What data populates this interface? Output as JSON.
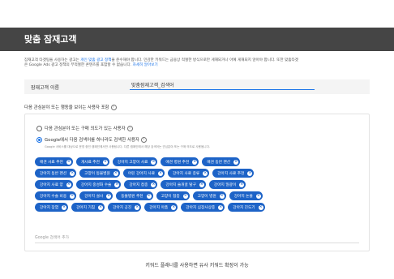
{
  "header": {
    "title": "맞춤 잠재고객"
  },
  "intro": {
    "line1_prefix": "잠재고객 타겟팅을 사용하는 광고는 ",
    "line1_link": "개인 맞춤 광고 정책",
    "line1_suffix": "을 준수해야 합니다. 민감한 키워드는 금융상 적절한 방식으로만 게재되거나 아예 게재되지 않아야 합니다. 또한 맞춤타겟",
    "line2_prefix": "은 Google Ads 광고 정책의 부적절한 콘텐츠를 포함할 수 없습니다. ",
    "line2_link": "자세히 알아보기"
  },
  "name_field": {
    "label": "잠재고객 이름",
    "value": "맞춤잠재고객_검색어"
  },
  "section_title": "다음 관심분야 또는 행동을 보이는 사용자 포함",
  "options": [
    {
      "label": "다음 관심분야 또는 구매 의도가 있는 사용자",
      "selected": false
    },
    {
      "label": "Google에서 다음 검색어를 하나라도 검색한 사용자",
      "selected": true
    }
  ],
  "option_description": "Google 서비스를 대상으로 운영 중인 캠페인에서만 사용됩니다. 다른 캠페인에서 해당 검색어는 관심분야 또는 구매 의도로 사용됩니다.",
  "keywords": [
    [
      "애견 사료 추천",
      "개사료 추천",
      "강아지 고양이 사료",
      "애견 병원 추천",
      "애견 동반 펜션"
    ],
    [
      "강아지 동반 펜션",
      "고양이 동물병원",
      "어린 강아지 사료",
      "강아지 사료 종류",
      "강아지 사료 추천"
    ],
    [
      "강아지 사료 양",
      "강아지 중성화 수술",
      "강아지 접종",
      "강아지 슬개골 탈구",
      "강아지 일광이"
    ],
    [
      "강아지 수술 비용",
      "강아지 설사",
      "동물병원 추천",
      "고양이 접종",
      "고양이 병원",
      "강아지 논물"
    ],
    [
      "강아지 장염",
      "강아지 기침",
      "강아지 공진",
      "강아지 아픔",
      "강아지 심장사상충",
      "강아지 진도기"
    ]
  ],
  "add_placeholder": "Google 검색어 추가",
  "help_icon": "?",
  "remove_icon": "×",
  "caption": "키워드 플래너를 사용하면 유사 키워드 확장이 가능",
  "colors": {
    "header": "#454545",
    "chip": "#1d63c7",
    "accent": "#1a73e8"
  }
}
